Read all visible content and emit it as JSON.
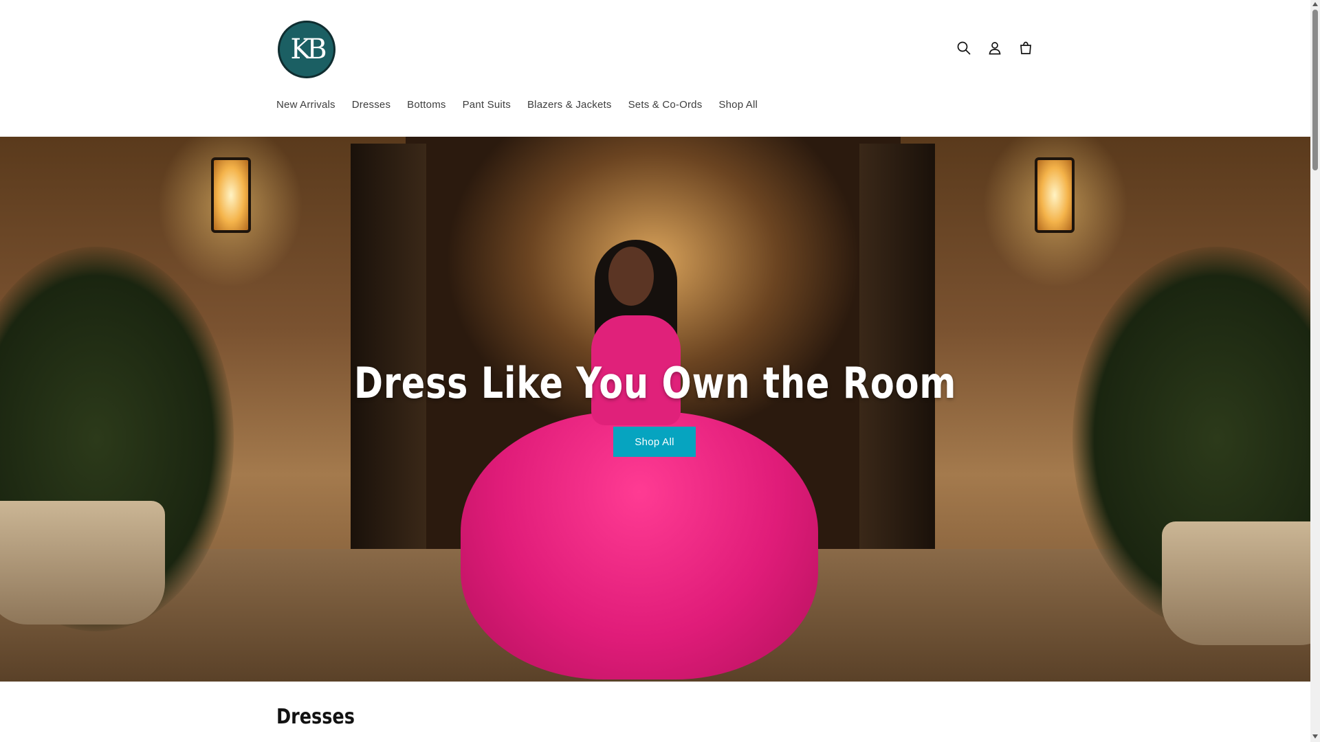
{
  "header": {
    "logo": {
      "text": "KB",
      "colors": {
        "fill": "#1b5f63",
        "ring": "#0f2d30"
      }
    },
    "icons": [
      {
        "name": "search-icon",
        "label": "Search"
      },
      {
        "name": "account-icon",
        "label": "Log in"
      },
      {
        "name": "cart-icon",
        "label": "Cart"
      }
    ],
    "nav": [
      {
        "label": "New Arrivals"
      },
      {
        "label": "Dresses"
      },
      {
        "label": "Bottoms"
      },
      {
        "label": "Pant Suits"
      },
      {
        "label": "Blazers & Jackets"
      },
      {
        "label": "Sets & Co-Ords"
      },
      {
        "label": "Shop All"
      }
    ]
  },
  "hero": {
    "title": "Dress Like You Own the Room",
    "button_label": "Shop All",
    "button_color": "#06a4c0"
  },
  "sections": {
    "featured_title": "Dresses"
  }
}
